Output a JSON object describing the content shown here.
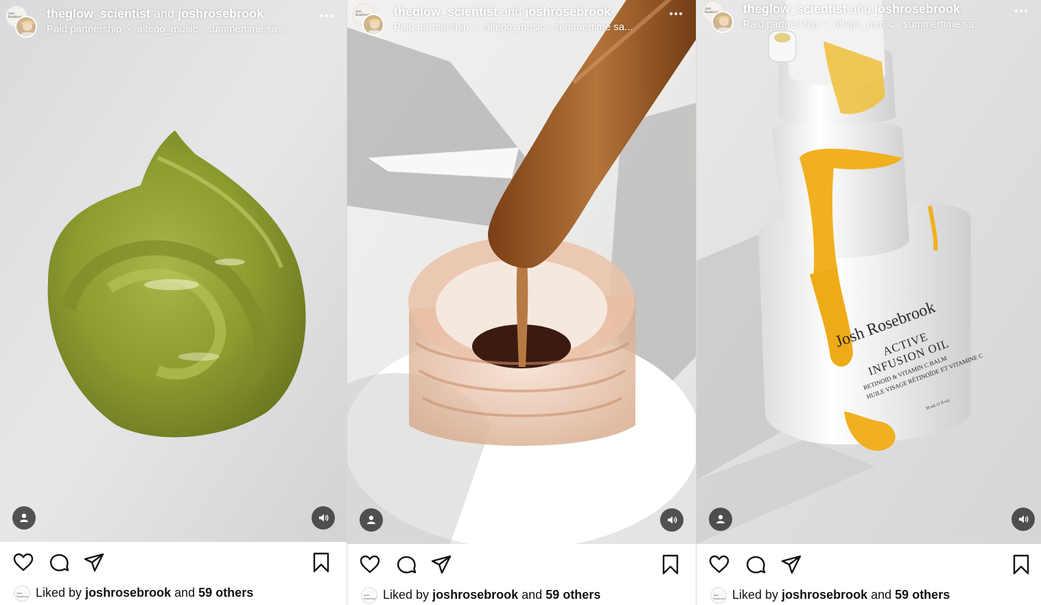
{
  "posts": [
    {
      "user1": "theglow_scientist",
      "joiner": "and",
      "user2": "joshrosebrook",
      "paid_label": "Paid partnership",
      "separator": "•",
      "audio": "altego_music · summertime sa...",
      "more_icon": "more-horizontal-icon",
      "tagged_icon": "person-icon",
      "sound_icon": "speaker-icon",
      "liked_prefix": "Liked by",
      "liked_user": "joshrosebrook",
      "liked_and": "and",
      "liked_others": "59 others"
    },
    {
      "user1": "theglow_scientist",
      "joiner": "and",
      "user2": "joshrosebrook",
      "paid_label": "Paid partnership",
      "separator": "•",
      "audio": "altego_music · summertime sa...",
      "more_icon": "more-horizontal-icon",
      "tagged_icon": "person-icon",
      "sound_icon": "speaker-icon",
      "liked_prefix": "Liked by",
      "liked_user": "joshrosebrook",
      "liked_and": "and",
      "liked_others": "59 others"
    },
    {
      "user1": "theglow_scientist",
      "joiner": "and",
      "user2": "joshrosebrook",
      "paid_label": "Paid partnership",
      "separator": "•",
      "audio": "altego_music · summertime sa...",
      "more_icon": "more-horizontal-icon",
      "tagged_icon": "person-icon",
      "sound_icon": "speaker-icon",
      "liked_prefix": "Liked by",
      "liked_user": "joshrosebrook",
      "liked_and": "and",
      "liked_others": "59 others"
    }
  ],
  "product_label": {
    "brand": "Josh Rosebrook",
    "line1": "ACTIVE",
    "line2": "INFUSION OIL",
    "line3": "RETINOID & VITAMIN C BALM",
    "line4": "HUILE VISAGE RÉTINOÏDE ET VITAMINE C",
    "volume": "30 mL (1 fl oz)"
  },
  "avatar_text": "Josh Rosebrook",
  "icons": [
    "heart-icon",
    "comment-icon",
    "share-icon",
    "bookmark-icon"
  ],
  "colors": {
    "text": "#111111",
    "overlay_button": "#282828",
    "gel_green": "#9aa83a",
    "honey": "#b5743a",
    "oil_yellow": "#f0b020"
  }
}
